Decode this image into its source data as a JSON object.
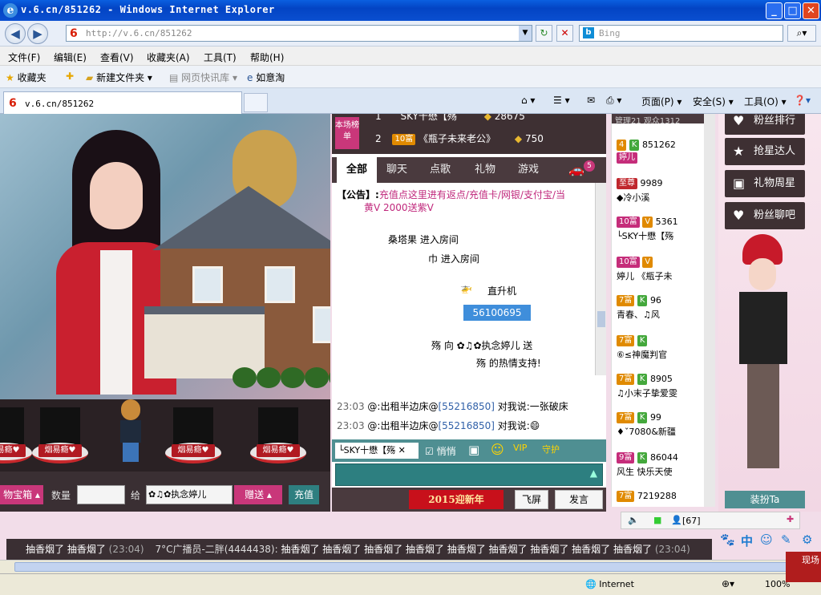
{
  "window": {
    "title": "v.6.cn/851262 - Windows Internet Explorer",
    "min": "_",
    "max": "□",
    "close": "✕"
  },
  "address": {
    "url": "http://v.6.cn/851262",
    "search_placeholder": "Bing"
  },
  "menu": [
    "文件(F)",
    "编辑(E)",
    "查看(V)",
    "收藏夹(A)",
    "工具(T)",
    "帮助(H)"
  ],
  "favorites": {
    "label": "收藏夹",
    "items": [
      "新建文件夹",
      "网页快讯库",
      "如意淘"
    ]
  },
  "tab": {
    "title": "v.6.cn/851262"
  },
  "commands": [
    "页面(P)",
    "安全(S)",
    "工具(O)"
  ],
  "ranking": {
    "tag": "本场榜单",
    "rows": [
      {
        "rank": "1",
        "level": "",
        "name": "SKY十懋【殇",
        "score": "28675"
      },
      {
        "rank": "2",
        "level": "10富",
        "name": "《瓶子未来老公》",
        "score": "750"
      }
    ]
  },
  "chat_tabs": [
    "全部",
    "聊天",
    "点歌",
    "礼物",
    "游戏"
  ],
  "chat_badge": "5",
  "chat": {
    "announcement_prefix": "【公告】:",
    "announcement": "充值点这里进有返点/充值卡/网银/支付宝/当",
    "announcement2": "黄V 2000送紫V",
    "lines": [
      "桑塔果 进入房间",
      "巾 进入房间"
    ],
    "heli_label": "直升机",
    "heli_id": "56100695",
    "gift_line": "殇 向 ✿♫✿执念婷儿 送",
    "thanks": "殇 的热情支持!",
    "pub": [
      {
        "time": "23:03",
        "name": "@:出租半边床@",
        "id": "[55216850]",
        "verb": "对我说:",
        "msg": "一张破床"
      },
      {
        "time": "23:03",
        "name": "@:出租半边床@",
        "id": "[55216850]",
        "verb": "对我说:",
        "msg": ""
      }
    ]
  },
  "chat_input": {
    "recipient": "└SKY十懋【殇",
    "quiet": "悄悄",
    "banner": "2015迎新年",
    "fly": "飞屏",
    "send": "发言"
  },
  "stage": {
    "cig_label": "烟易瘾♥"
  },
  "gift_bar": {
    "select": "物宝箱",
    "qty_label": "数量",
    "to_label": "给",
    "to_value": "✿♫✿执念婷儿",
    "give": "赠送",
    "recharge": "充值"
  },
  "userlist": {
    "head": "管理21    观众1312",
    "users": [
      {
        "level": "4",
        "name": "851262",
        "sub": "婷儿"
      },
      {
        "level": "至尊",
        "name": "9989",
        "sub": "◆冷小溪"
      },
      {
        "level": "10富",
        "name": "5361",
        "sub": "└SKY十懋【殇"
      },
      {
        "level": "10富",
        "name": "",
        "sub": "婷儿  《瓶子未"
      },
      {
        "level": "7富",
        "name": "96",
        "sub": "青春、♫风"
      },
      {
        "level": "7富",
        "name": "",
        "sub": "⑥≤神魔判官"
      },
      {
        "level": "7富",
        "name": "8905",
        "sub": "♫小末子挚爱雯"
      },
      {
        "level": "7富",
        "name": "99",
        "sub": "♦ˇ7080&新疆"
      },
      {
        "level": "9富",
        "name": "86044",
        "sub": "风生  快乐天使"
      },
      {
        "level": "7富",
        "name": "7219288",
        "sub": ""
      }
    ],
    "online": "[67]"
  },
  "side": {
    "buttons": [
      "粉丝排行",
      "抢星达人",
      "礼物周星",
      "粉丝聊吧"
    ],
    "dress": "装扮Ta"
  },
  "ticker": {
    "text1": "抽香烟了 抽香烟了",
    "time1": "(23:04)",
    "temp": "7°C广播员-二胖(4444438):",
    "text2": "抽香烟了 抽香烟了 抽香烟了 抽香烟了 抽香烟了 抽香烟了 抽香烟了 抽香烟了 抽香烟了",
    "time2": "(23:04)"
  },
  "status": {
    "zone": "Internet",
    "zoom": "100%"
  },
  "corner": "现场"
}
